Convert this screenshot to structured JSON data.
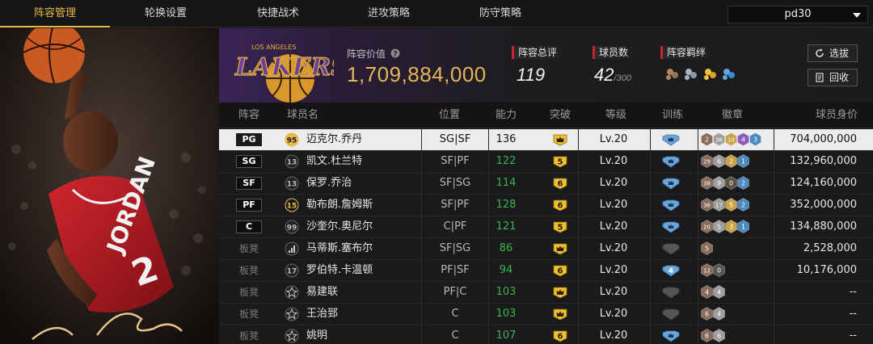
{
  "nav": {
    "tabs": [
      "阵容管理",
      "轮换设置",
      "快捷战术",
      "进攻策略",
      "防守策略"
    ],
    "active_tab": 0,
    "roster_selector": "pd30"
  },
  "team": {
    "logo_text": "LAKERS",
    "logo_subtext": "LOS ANGELES",
    "value_label": "阵容价值",
    "value": "1,709,884,000",
    "rating_label": "阵容总评",
    "rating": "119",
    "players_label": "球员数",
    "players_count": "42",
    "players_max": "/300",
    "synergy_label": "阵容羁绊",
    "buttons": {
      "select": "选拔",
      "recycle": "回收"
    }
  },
  "table": {
    "headers": [
      "阵容",
      "球员名",
      "位置",
      "能力",
      "突破",
      "等级",
      "训练",
      "徽章",
      "球员身价"
    ],
    "rows": [
      {
        "slot": "PG",
        "starter": true,
        "ovr": "95",
        "ovr_style": "gold",
        "name": "迈克尔.乔丹",
        "pos": "SG|SF",
        "ability": "136",
        "ability_color": "#ffffff",
        "breakthrough": "crown",
        "level": "Lv.20",
        "train": "shield-crown",
        "badges": [
          {
            "n": "2",
            "c": "#8a6a58"
          },
          {
            "n": "36",
            "c": "#9e9e9e"
          },
          {
            "n": "10",
            "c": "#c9a34a"
          },
          {
            "n": "4",
            "c": "#8e5ab8"
          },
          {
            "n": "3",
            "c": "#4a8ac0"
          }
        ],
        "price": "704,000,000"
      },
      {
        "slot": "SG",
        "starter": true,
        "ovr": "13",
        "ovr_style": "plain",
        "name": "凯文.杜兰特",
        "pos": "SF|PF",
        "ability": "122",
        "ability_color": "#39b54a",
        "breakthrough": "5",
        "level": "Lv.20",
        "train": "shield-crown",
        "badges": [
          {
            "n": "29",
            "c": "#8a6a58"
          },
          {
            "n": "6",
            "c": "#9e9e9e"
          },
          {
            "n": "2",
            "c": "#c9a34a"
          },
          {
            "n": "1",
            "c": "#4a8ac0"
          }
        ],
        "price": "132,960,000"
      },
      {
        "slot": "SF",
        "starter": true,
        "ovr": "13",
        "ovr_style": "plain",
        "name": "保罗.乔治",
        "pos": "SF|SG",
        "ability": "114",
        "ability_color": "#39b54a",
        "breakthrough": "6",
        "level": "Lv.20",
        "train": "shield-crown",
        "badges": [
          {
            "n": "38",
            "c": "#8a6a58"
          },
          {
            "n": "9",
            "c": "#9e9e9e"
          },
          {
            "n": "0",
            "c": "#5a5040"
          },
          {
            "n": "2",
            "c": "#4a8ac0"
          }
        ],
        "price": "124,160,000"
      },
      {
        "slot": "PF",
        "starter": true,
        "ovr": "15",
        "ovr_style": "ring",
        "name": "勒布朗.詹姆斯",
        "pos": "SF|PF",
        "ability": "128",
        "ability_color": "#39b54a",
        "breakthrough": "6",
        "level": "Lv.20",
        "train": "shield-crown",
        "badges": [
          {
            "n": "36",
            "c": "#8a6a58"
          },
          {
            "n": "17",
            "c": "#9e9e9e"
          },
          {
            "n": "5",
            "c": "#c9a34a"
          },
          {
            "n": "2",
            "c": "#4a8ac0"
          }
        ],
        "price": "352,000,000"
      },
      {
        "slot": "C",
        "starter": true,
        "ovr": "99",
        "ovr_style": "plain",
        "name": "沙奎尔.奥尼尔",
        "pos": "C|PF",
        "ability": "121",
        "ability_color": "#39b54a",
        "breakthrough": "5",
        "level": "Lv.20",
        "train": "shield-crown",
        "badges": [
          {
            "n": "20",
            "c": "#8a6a58"
          },
          {
            "n": "5",
            "c": "#9e9e9e"
          },
          {
            "n": "3",
            "c": "#c9a34a"
          },
          {
            "n": "1",
            "c": "#4a8ac0"
          }
        ],
        "price": "134,880,000"
      },
      {
        "slot": "板凳",
        "starter": false,
        "ovr": "",
        "ovr_style": "bars",
        "name": "马蒂斯.塞布尔",
        "pos": "SF|SG",
        "ability": "86",
        "ability_color": "#39b54a",
        "breakthrough": "crown",
        "level": "Lv.20",
        "train": "shield-gray",
        "badges": [
          {
            "n": "5",
            "c": "#8a6a58"
          }
        ],
        "price": "2,528,000"
      },
      {
        "slot": "板凳",
        "starter": false,
        "ovr": "17",
        "ovr_style": "plain",
        "name": "罗伯特.卡温顿",
        "pos": "PF|SF",
        "ability": "94",
        "ability_color": "#39b54a",
        "breakthrough": "6",
        "level": "Lv.20",
        "train": "shield-4",
        "badges": [
          {
            "n": "12",
            "c": "#8a6a58"
          },
          {
            "n": "0",
            "c": "#555"
          }
        ],
        "price": "10,176,000"
      },
      {
        "slot": "板凳",
        "starter": false,
        "ovr": "",
        "ovr_style": "star",
        "name": "易建联",
        "pos": "PF|C",
        "ability": "103",
        "ability_color": "#39b54a",
        "breakthrough": "crown",
        "level": "Lv.20",
        "train": "shield-gray",
        "badges": [
          {
            "n": "4",
            "c": "#8a6a58"
          },
          {
            "n": "4",
            "c": "#9e9e9e"
          }
        ],
        "price": "--"
      },
      {
        "slot": "板凳",
        "starter": false,
        "ovr": "",
        "ovr_style": "star",
        "name": "王治郅",
        "pos": "C",
        "ability": "103",
        "ability_color": "#39b54a",
        "breakthrough": "crown",
        "level": "Lv.20",
        "train": "shield-gray",
        "badges": [
          {
            "n": "6",
            "c": "#8a6a58"
          },
          {
            "n": "4",
            "c": "#9e9e9e"
          }
        ],
        "price": "--"
      },
      {
        "slot": "板凳",
        "starter": false,
        "ovr": "",
        "ovr_style": "star",
        "name": "姚明",
        "pos": "C",
        "ability": "107",
        "ability_color": "#39b54a",
        "breakthrough": "6",
        "level": "Lv.20",
        "train": "shield-crown",
        "badges": [
          {
            "n": "6",
            "c": "#8a6a58"
          },
          {
            "n": "6",
            "c": "#9e9e9e"
          }
        ],
        "price": "--"
      }
    ]
  },
  "colors": {
    "accent": "#e8b84a",
    "gold_value": "#e5b457",
    "ability_green": "#39b54a",
    "label_red": "#c9232b"
  }
}
